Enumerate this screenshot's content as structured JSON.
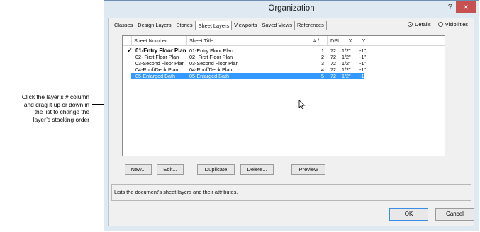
{
  "callout": {
    "lines": [
      "Click the layer’s # column",
      "and drag it up or down in",
      "the list to change the",
      "layer’s stacking order"
    ]
  },
  "dialog": {
    "title": "Organization",
    "help_label": "?",
    "close_label": "×",
    "tabs": [
      "Classes",
      "Design Layers",
      "Stories",
      "Sheet Layers",
      "Viewports",
      "Saved Views",
      "References"
    ],
    "active_tab": "Sheet Layers",
    "view_options": [
      {
        "label": "Details",
        "selected": true
      },
      {
        "label": "Visibilities",
        "selected": false
      }
    ],
    "columns": {
      "sheet_number": "Sheet Number",
      "sheet_title": "Sheet Title",
      "stack": "# /",
      "dpi": "DPI",
      "x": "X",
      "y": "Y"
    },
    "rows": [
      {
        "checked": true,
        "number": "01-Entry Floor Plan",
        "title": "01-Entry Floor Plan",
        "stack": "1",
        "dpi": "72",
        "x": "1/2\"",
        "y": "-1\"",
        "bold": true,
        "selected": false
      },
      {
        "checked": false,
        "number": "02- First Floor Plan",
        "title": "02- First Floor Plan",
        "stack": "2",
        "dpi": "72",
        "x": "1/2\"",
        "y": "-1\"",
        "bold": false,
        "selected": false
      },
      {
        "checked": false,
        "number": "03-Second Floor Plan",
        "title": "03-Second Floor Plan",
        "stack": "3",
        "dpi": "72",
        "x": "1/2\"",
        "y": "-1\"",
        "bold": false,
        "selected": false
      },
      {
        "checked": false,
        "number": "04-Roof/Deck Plan",
        "title": "04-Roof/Deck Plan",
        "stack": "4",
        "dpi": "72",
        "x": "1/2\"",
        "y": "-1\"",
        "bold": false,
        "selected": false
      },
      {
        "checked": false,
        "number": "05-Enlarged Bath",
        "title": "05-Enlarged Bath",
        "stack": "5",
        "dpi": "72",
        "x": "1/2\"",
        "y": "-1\"",
        "bold": false,
        "selected": true
      }
    ],
    "check_mark": "✔",
    "buttons": {
      "new": "New...",
      "edit": "Edit...",
      "duplicate": "Duplicate",
      "delete": "Delete...",
      "preview": "Preview",
      "ok": "OK",
      "cancel": "Cancel"
    },
    "description": "Lists the document's sheet layers and their attributes."
  }
}
